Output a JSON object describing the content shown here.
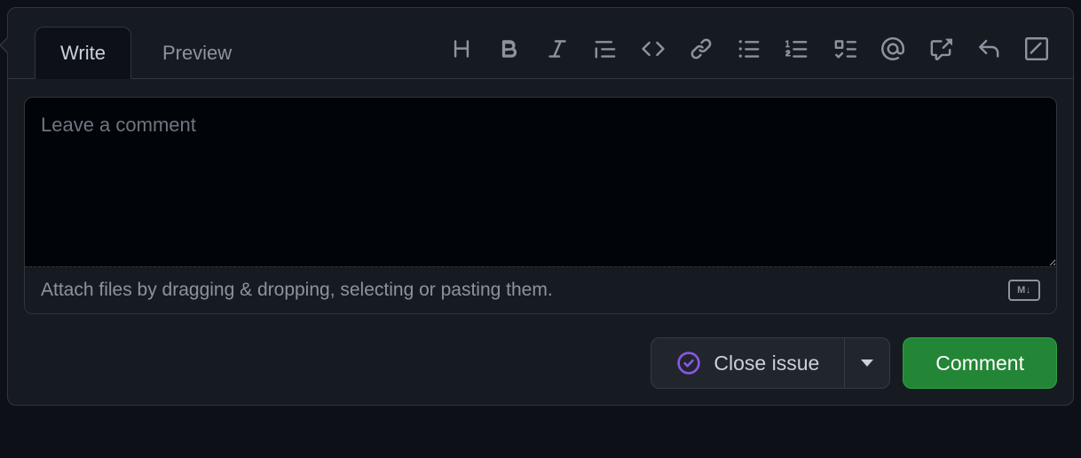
{
  "tabs": {
    "write": "Write",
    "preview": "Preview"
  },
  "editor": {
    "placeholder": "Leave a comment",
    "attach_hint": "Attach files by dragging & dropping, selecting or pasting them.",
    "md_badge": "M↓"
  },
  "actions": {
    "close_label": "Close issue",
    "comment_label": "Comment"
  },
  "toolbar": {
    "heading": "Heading",
    "bold": "Bold",
    "italic": "Italic",
    "quote": "Quote",
    "code": "Code",
    "link": "Link",
    "ul": "Bulleted list",
    "ol": "Numbered list",
    "tasklist": "Task list",
    "mention": "Mention",
    "reference": "Reference",
    "reply": "Saved reply",
    "slash": "Slash commands"
  }
}
